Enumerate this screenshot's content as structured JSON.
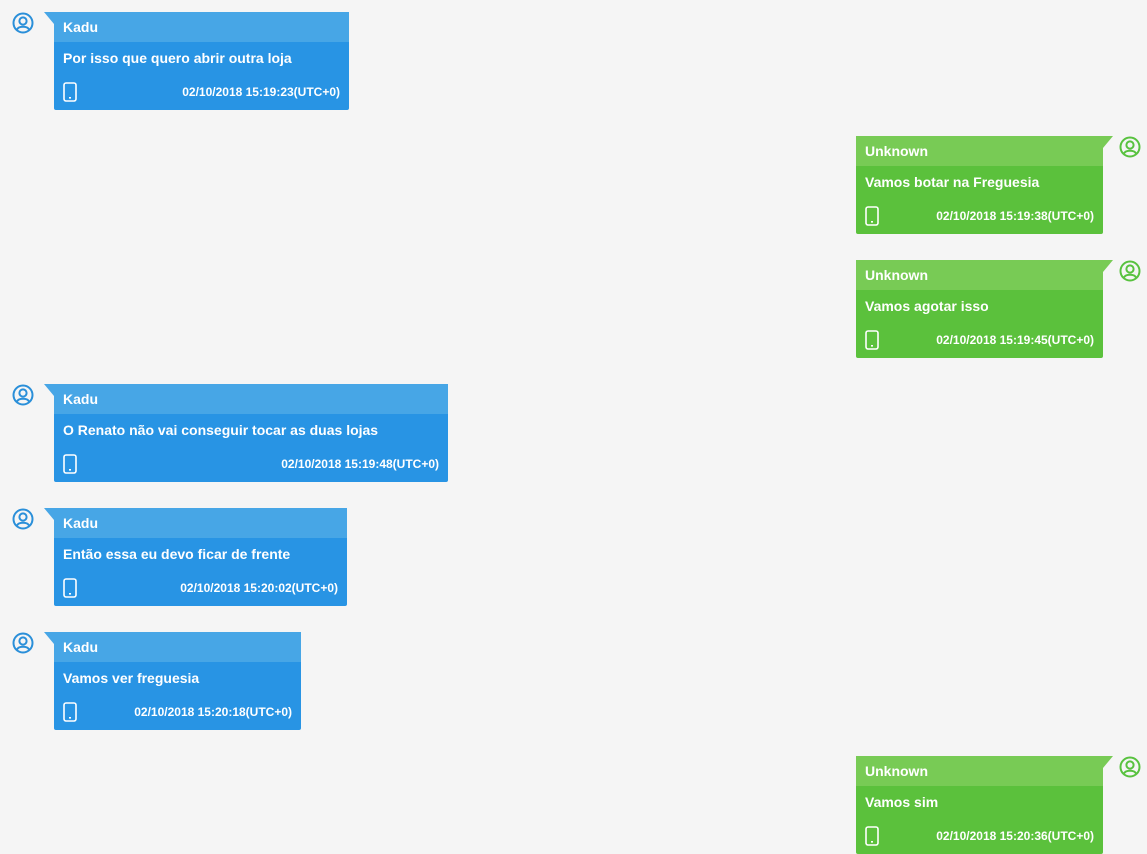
{
  "colors": {
    "background": "#f5f5f5",
    "incoming_body": "#2894e4",
    "incoming_header": "#47a6e6",
    "outgoing_body": "#5bc13c",
    "outgoing_header": "#78cb55"
  },
  "icons": {
    "avatar": "user-icon",
    "device": "phone-icon"
  },
  "messages": [
    {
      "direction": "incoming",
      "sender": "Kadu",
      "text": "Por isso que quero abrir outra loja",
      "timestamp": "02/10/2018 15:19:23(UTC+0)"
    },
    {
      "direction": "outgoing",
      "sender": "Unknown",
      "text": "Vamos botar na Freguesia",
      "timestamp": "02/10/2018 15:19:38(UTC+0)"
    },
    {
      "direction": "outgoing",
      "sender": "Unknown",
      "text": "Vamos agotar isso",
      "timestamp": "02/10/2018 15:19:45(UTC+0)"
    },
    {
      "direction": "incoming",
      "sender": "Kadu",
      "text": "O Renato não vai conseguir tocar as duas lojas",
      "timestamp": "02/10/2018 15:19:48(UTC+0)"
    },
    {
      "direction": "incoming",
      "sender": "Kadu",
      "text": "Então essa eu devo ficar de frente",
      "timestamp": "02/10/2018 15:20:02(UTC+0)"
    },
    {
      "direction": "incoming",
      "sender": "Kadu",
      "text": "Vamos ver freguesia",
      "timestamp": "02/10/2018 15:20:18(UTC+0)"
    },
    {
      "direction": "outgoing",
      "sender": "Unknown",
      "text": "Vamos sim",
      "timestamp": "02/10/2018 15:20:36(UTC+0)"
    }
  ]
}
